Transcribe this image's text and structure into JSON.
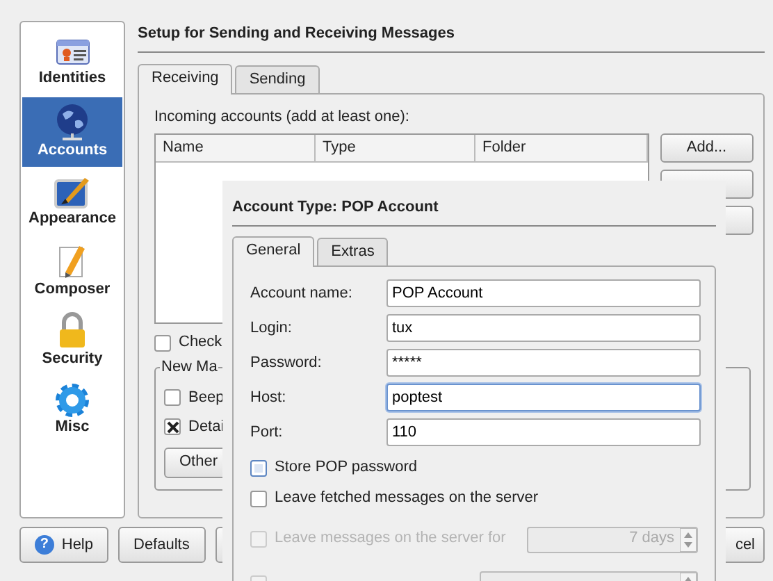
{
  "sidebar": {
    "items": [
      {
        "label": "Identities",
        "kind": "identity",
        "selected": false
      },
      {
        "label": "Accounts",
        "kind": "globe",
        "selected": true
      },
      {
        "label": "Appearance",
        "kind": "brush",
        "selected": false
      },
      {
        "label": "Composer",
        "kind": "pencil",
        "selected": false
      },
      {
        "label": "Security",
        "kind": "lock",
        "selected": false
      },
      {
        "label": "Misc",
        "kind": "gear",
        "selected": false
      }
    ]
  },
  "page_title": "Setup for Sending and Receiving Messages",
  "tabs": [
    {
      "label": "Receiving",
      "selected": true
    },
    {
      "label": "Sending",
      "selected": false
    }
  ],
  "incoming_label": "Incoming accounts (add at least one):",
  "accounts_table": {
    "columns": [
      "Name",
      "Type",
      "Folder"
    ]
  },
  "add_button": "Add...",
  "check_option": {
    "label": "Check",
    "checked": false
  },
  "new_mail_group": {
    "title": "New Ma",
    "options": [
      {
        "label": "Beep",
        "checked": false
      },
      {
        "label": "Detai",
        "checked": true
      }
    ],
    "button": "Other"
  },
  "bottom_buttons": [
    {
      "label": "Help",
      "kind": "help",
      "icon": "?"
    },
    {
      "label": "Defaults",
      "kind": "plain"
    }
  ],
  "cancel_button": "cel",
  "dialog": {
    "title": "Account Type: POP Account",
    "tabs": [
      {
        "label": "General",
        "selected": true
      },
      {
        "label": "Extras",
        "selected": false
      }
    ],
    "fields": [
      {
        "label": "Account name:",
        "value": "POP Account",
        "focused": false
      },
      {
        "label": "Login:",
        "value": "tux",
        "focused": false
      },
      {
        "label": "Password:",
        "value": "*****",
        "focused": false
      },
      {
        "label": "Host:",
        "value": "poptest",
        "focused": true
      },
      {
        "label": "Port:",
        "value": "110",
        "focused": false
      }
    ],
    "options": [
      {
        "kind": "plain",
        "label": "Store POP password",
        "checked": false,
        "disabled": false,
        "highlighted": true
      },
      {
        "kind": "plain",
        "label": "Leave fetched messages on the server",
        "checked": false,
        "disabled": false,
        "highlighted": false
      },
      {
        "kind": "spin",
        "label": "Leave messages on the server for",
        "checked": false,
        "disabled": true,
        "highlighted": false,
        "spin": "7 days"
      },
      {
        "kind": "spin",
        "checked": false,
        "disabled": true,
        "highlighted": false
      }
    ]
  }
}
